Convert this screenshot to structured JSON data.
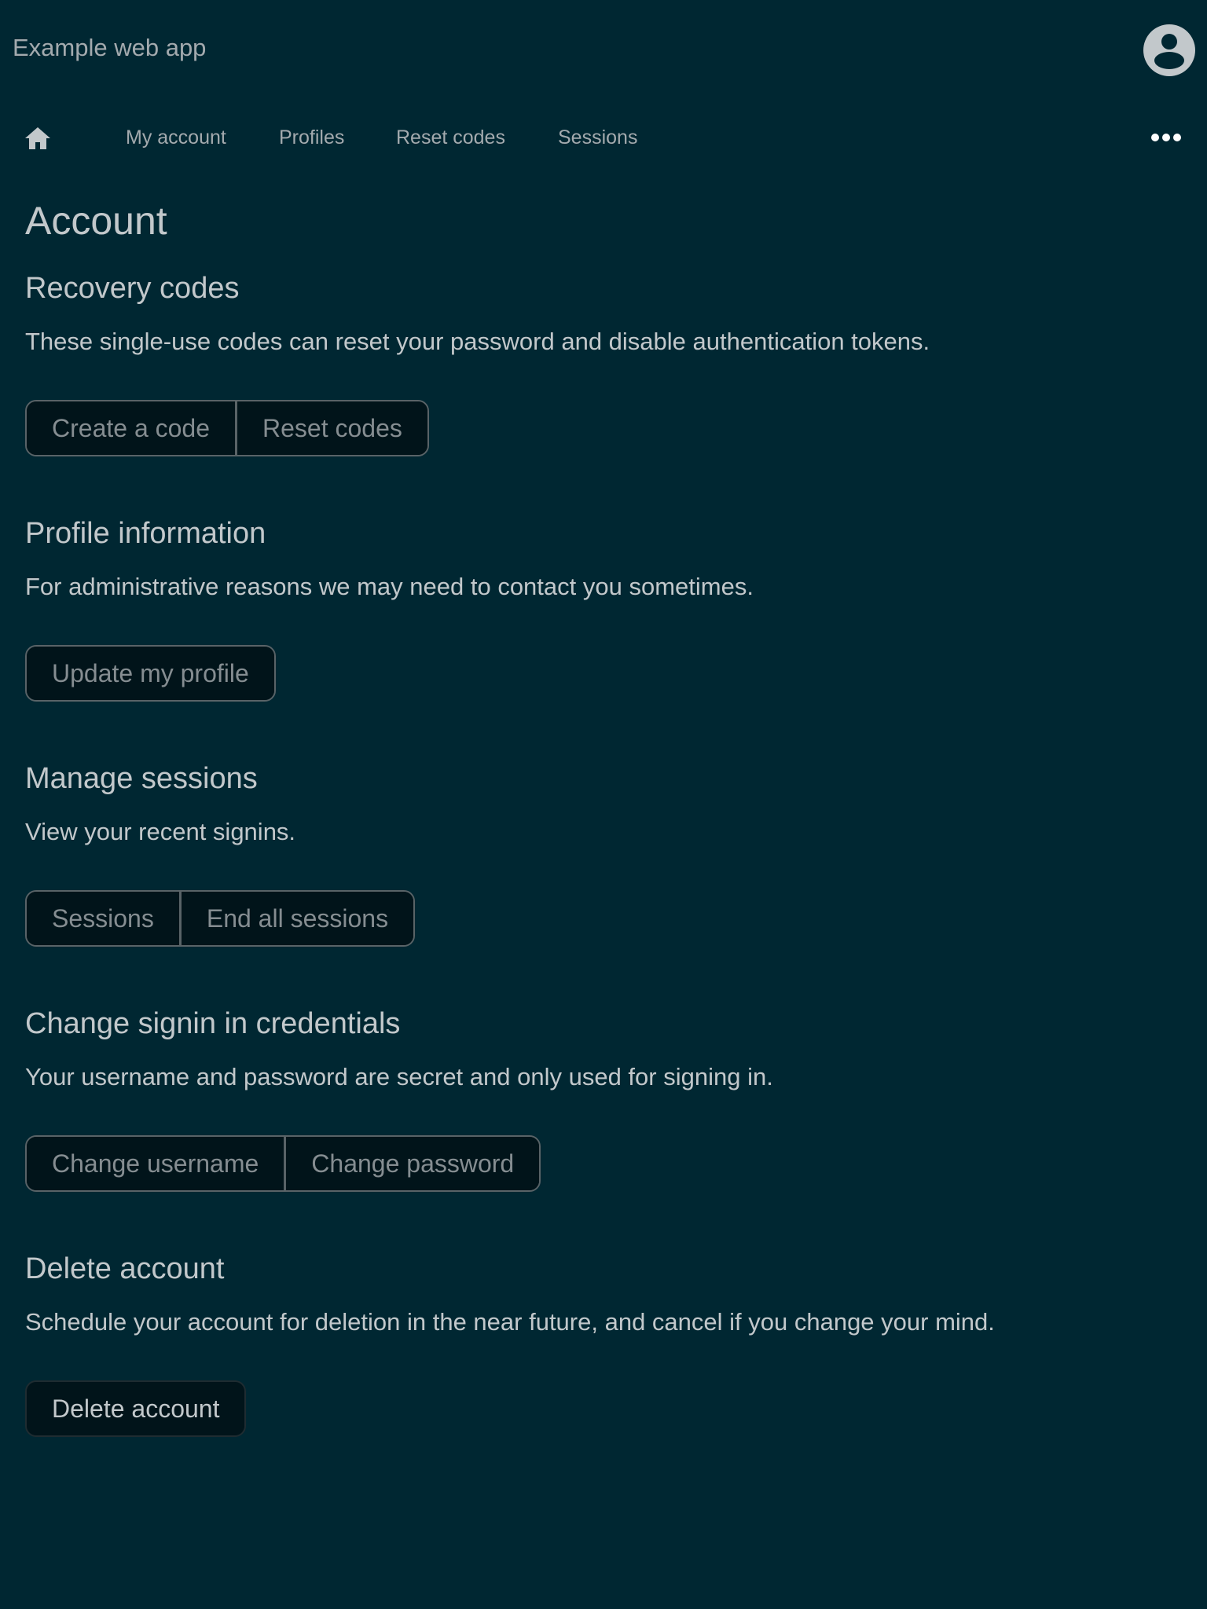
{
  "header": {
    "title": "Example web app",
    "avatar_icon": "user-circle-icon"
  },
  "nav": {
    "home_icon": "home-icon",
    "items": [
      {
        "label": "My account"
      },
      {
        "label": "Profiles"
      },
      {
        "label": "Reset codes"
      },
      {
        "label": "Sessions"
      }
    ],
    "more_icon": "more-horizontal-icon"
  },
  "page": {
    "title": "Account"
  },
  "sections": [
    {
      "heading": "Recovery codes",
      "description": "These single-use codes can reset your password and disable authentication tokens.",
      "buttons": [
        "Create a code",
        "Reset codes"
      ]
    },
    {
      "heading": "Profile information",
      "description": "For administrative reasons we may need to contact you sometimes.",
      "buttons": [
        "Update my profile"
      ]
    },
    {
      "heading": "Manage sessions",
      "description": "View your recent signins.",
      "buttons": [
        "Sessions",
        "End all sessions"
      ]
    },
    {
      "heading": "Change signin in credentials",
      "description": "Your username and password are secret and only used for signing in.",
      "buttons": [
        "Change username",
        "Change password"
      ]
    },
    {
      "heading": "Delete account",
      "description": "Schedule your account for deletion in the near future, and cancel if you change your mind.",
      "buttons": [
        "Delete account"
      ]
    }
  ],
  "colors": {
    "background": "#002732",
    "text": "#c2c8cb",
    "muted_text": "#a3aaae",
    "button_background": "#01141a",
    "button_text": "#858d91",
    "button_border": "#596367"
  }
}
